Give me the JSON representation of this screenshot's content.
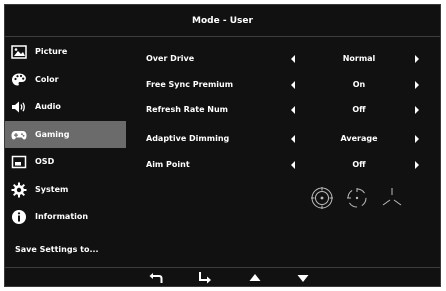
{
  "window": {
    "title": "Mode - User"
  },
  "sidebar": {
    "items": [
      {
        "label": "Picture",
        "icon": "picture-icon"
      },
      {
        "label": "Color",
        "icon": "palette-icon"
      },
      {
        "label": "Audio",
        "icon": "speaker-icon"
      },
      {
        "label": "Gaming",
        "icon": "gamepad-icon",
        "active": true
      },
      {
        "label": "OSD",
        "icon": "osd-window-icon"
      },
      {
        "label": "System",
        "icon": "gear-icon"
      },
      {
        "label": "Information",
        "icon": "info-icon"
      }
    ],
    "save_label": "Save Settings to..."
  },
  "settings": [
    {
      "label": "Over Drive",
      "value": "Normal"
    },
    {
      "label": "Free Sync Premium",
      "value": "On"
    },
    {
      "label": "Refresh Rate Num",
      "value": "Off"
    },
    {
      "label": "Adaptive Dimming",
      "value": "Average"
    },
    {
      "label": "Aim Point",
      "value": "Off"
    }
  ],
  "aim_point_options": [
    "crosshair-circle-dot-icon",
    "crosshair-circle-icon",
    "crosshair-y-icon"
  ],
  "bottom_bar": {
    "buttons": [
      "return-icon",
      "enter-icon",
      "up-arrow-icon",
      "down-arrow-icon"
    ]
  },
  "colors": {
    "background": "#111111",
    "active": "#6b6b6b",
    "text": "#ffffff"
  }
}
